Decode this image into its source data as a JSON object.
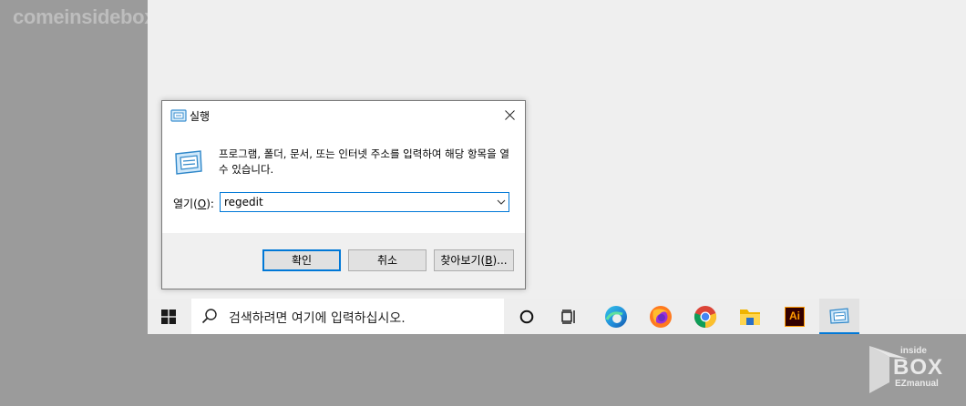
{
  "watermark": {
    "top_text": "comeinsidebox.com"
  },
  "dialog": {
    "title": "실행",
    "description": "프로그램, 폴더, 문서, 또는 인터넷 주소를 입력하여 해당 항목을 열 수 있습니다.",
    "open_label_prefix": "열기(",
    "open_label_key": "O",
    "open_label_suffix": "):",
    "input_value": "regedit",
    "ok_label": "확인",
    "cancel_label": "취소",
    "browse_label_prefix": "찾아보기(",
    "browse_label_key": "B",
    "browse_label_suffix": ")..."
  },
  "taskbar": {
    "search_placeholder": "검색하려면 여기에 입력하십시오.",
    "items": [
      {
        "icon": "cortana-icon"
      },
      {
        "icon": "task-view-icon"
      },
      {
        "icon": "edge-icon"
      },
      {
        "icon": "firefox-icon"
      },
      {
        "icon": "chrome-icon"
      },
      {
        "icon": "file-explorer-icon"
      },
      {
        "icon": "illustrator-icon",
        "label": "Ai"
      },
      {
        "icon": "run-icon",
        "active": true
      }
    ]
  },
  "logo": {
    "line1": "inside",
    "line2": "BOX",
    "line3": "EZmanual"
  },
  "colors": {
    "accent": "#0078d7",
    "desktop": "#efefef",
    "backdrop": "#9b9b9b"
  }
}
